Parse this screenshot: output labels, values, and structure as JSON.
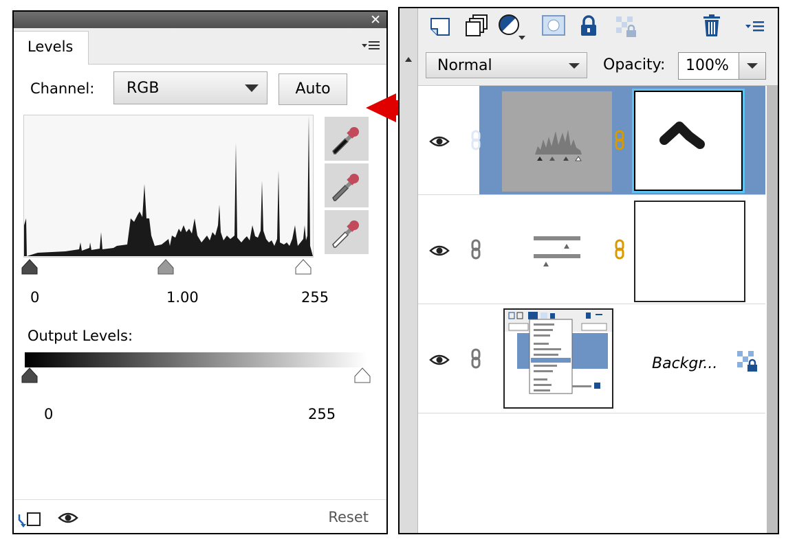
{
  "levels_panel": {
    "tab_label": "Levels",
    "channel_label": "Channel:",
    "channel_value": "RGB",
    "auto_label": "Auto",
    "input_levels": {
      "black": "0",
      "gamma": "1.00",
      "white": "255"
    },
    "output_levels_label": "Output Levels:",
    "output_levels": {
      "black": "0",
      "white": "255"
    },
    "reset_label": "Reset"
  },
  "layers_panel": {
    "blend_mode": "Normal",
    "opacity_label": "Opacity:",
    "opacity_value": "100%",
    "layers": [
      {
        "type": "levels-adjustment",
        "selected": true
      },
      {
        "type": "adjustment",
        "selected": false
      },
      {
        "type": "background",
        "name": "Backgr...",
        "selected": false
      }
    ]
  },
  "colors": {
    "selected_row": "#6d93c4",
    "selection_outline": "#5ec3f0",
    "link_orange": "#d99a00",
    "annotation_arrow": "#e00000"
  }
}
